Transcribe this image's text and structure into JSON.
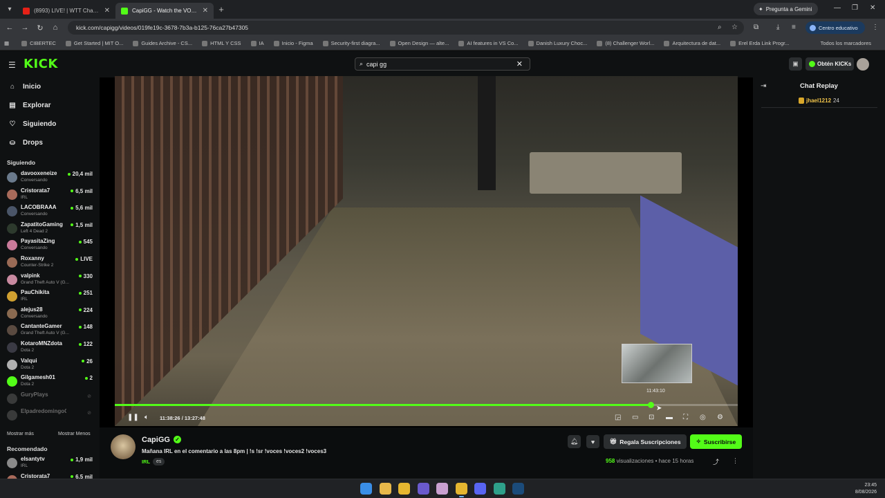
{
  "browser": {
    "tabs": [
      {
        "label": "(8993) LIVE! | WTT Champions",
        "favicon_color": "#e62117",
        "active": false
      },
      {
        "label": "CapiGG - Watch the VOD o",
        "favicon_color": "#53fc18",
        "active": true
      }
    ],
    "gemini_label": "Pregunta a Gemini",
    "url": "kick.com/capigg/videos/019fe19c-3678-7b3a-b125-76ca27b47305",
    "profile_label": "Centro educativo",
    "bookmarks": [
      "CIBERTEC",
      "Get Started | MIT O...",
      "Guides Archive - CS...",
      "HTML Y CSS",
      "IA",
      "Inicio - Figma",
      "Security-first diagra...",
      "Open Design — alte...",
      "AI features in VS Co...",
      "Danish Luxury Choc...",
      "(8) Challenger Worl...",
      "Arquitectura de dat...",
      "Erel Erda Link Progr..."
    ],
    "bookmarks_all": "Todos los marcadores"
  },
  "header": {
    "logo": "KICK",
    "search_value": "capi gg",
    "get_kicks": "Obtén KICKs"
  },
  "sidebar": {
    "nav": [
      {
        "label": "Inicio",
        "icon": "home-icon",
        "glyph": "⌂"
      },
      {
        "label": "Explorar",
        "icon": "browse-icon",
        "glyph": "▤"
      },
      {
        "label": "Siguiendo",
        "icon": "heart-icon",
        "glyph": "♡"
      },
      {
        "label": "Drops",
        "icon": "drops-icon",
        "glyph": "⛀"
      }
    ],
    "following_title": "Siguiendo",
    "following": [
      {
        "name": "davooxeneize",
        "category": "Conversando",
        "viewers": "20,4 mil",
        "avatar": "#6a7a8c"
      },
      {
        "name": "Cristorata7",
        "category": "IRL",
        "viewers": "6,5 mil",
        "avatar": "#a86a5a"
      },
      {
        "name": "LACOBRAAA",
        "category": "Conversando",
        "viewers": "5,6 mil",
        "avatar": "#4a5568"
      },
      {
        "name": "ZapatitoGaming",
        "category": "Left 4 Dead 2",
        "viewers": "1,5 mil",
        "avatar": "#2d3a2d"
      },
      {
        "name": "PayasitaZing",
        "category": "Conversando",
        "viewers": "545",
        "avatar": "#c97a9a"
      },
      {
        "name": "Roxanny",
        "category": "Counter-Strike 2",
        "viewers": "LIVE",
        "avatar": "#9a6a55"
      },
      {
        "name": "valpink",
        "category": "Grand Theft Auto V (G...",
        "viewers": "330",
        "avatar": "#c98aa0"
      },
      {
        "name": "PauChikita",
        "category": "IRL",
        "viewers": "251",
        "avatar": "#d0a030"
      },
      {
        "name": "alejus28",
        "category": "Conversando",
        "viewers": "224",
        "avatar": "#8a6a50"
      },
      {
        "name": "CantanteGamer",
        "category": "Grand Theft Auto V (G...",
        "viewers": "148",
        "avatar": "#5a4a40"
      },
      {
        "name": "KotaroMNZdota",
        "category": "Dota 2",
        "viewers": "122",
        "avatar": "#3a3a44"
      },
      {
        "name": "Valqui",
        "category": "Dota 2",
        "viewers": "26",
        "avatar": "#b0b0b0"
      },
      {
        "name": "Gilgamesh01",
        "category": "Dota 2",
        "viewers": "2",
        "avatar": "#53fc18"
      }
    ],
    "offline": [
      {
        "name": "GuryPlays",
        "avatar": "#777"
      },
      {
        "name": "ElpadredomingoOficial",
        "avatar": "#777"
      }
    ],
    "show_more": "Mostrar más",
    "show_less": "Mostrar Menos",
    "recommended_title": "Recomendado",
    "recommended": [
      {
        "name": "elsantytv",
        "category": "IRL",
        "viewers": "1,9 mil",
        "avatar": "#8a8a8a"
      },
      {
        "name": "Cristorata7",
        "category": "",
        "viewers": "6,5 mil",
        "avatar": "#a86a5a"
      }
    ]
  },
  "player": {
    "current_time": "11:38:26",
    "duration": "13:27:48",
    "time_label": "11:38:26 / 13:27:48",
    "progress": 0.86,
    "hover_time": "11:43:10",
    "controls_icons": [
      "pause-icon",
      "volume-icon",
      "miniplayer-icon",
      "clip-icon",
      "captions-icon",
      "theater-icon",
      "fullscreen-icon",
      "speed-icon",
      "settings-icon"
    ]
  },
  "chat": {
    "title": "Chat Replay",
    "messages": [
      {
        "user": "jhael1212",
        "text": "24"
      }
    ]
  },
  "stream": {
    "streamer": "CapiGG",
    "title": "Mañana IRL en el comentario a las 8pm | !s !sr !voces !voces2 !voces3",
    "category": "IRL",
    "language": "es",
    "gift_label": "Regala Suscripciones",
    "subscribe_label": "Suscribirse",
    "views_count": "958",
    "views_label": "visualizaciones",
    "time_ago": "hace 15 horas"
  },
  "taskbar": {
    "time": "23:45",
    "date": "8/08/2026",
    "apps": [
      {
        "name": "start-icon",
        "color": "#3a8ee6"
      },
      {
        "name": "file-explorer-icon",
        "color": "#e8b84a"
      },
      {
        "name": "chrome-icon",
        "color": "#e5b630"
      },
      {
        "name": "app-icon",
        "color": "#6a5acd"
      },
      {
        "name": "app-icon-2",
        "color": "#c9a0d0"
      },
      {
        "name": "chrome-active-icon",
        "color": "#e5b630"
      },
      {
        "name": "discord-icon",
        "color": "#5865f2"
      },
      {
        "name": "app-icon-3",
        "color": "#2ea08a"
      },
      {
        "name": "steam-icon",
        "color": "#1b4b7a"
      }
    ]
  },
  "colors": {
    "accent": "#53fc18",
    "background": "#0b0d0e"
  }
}
